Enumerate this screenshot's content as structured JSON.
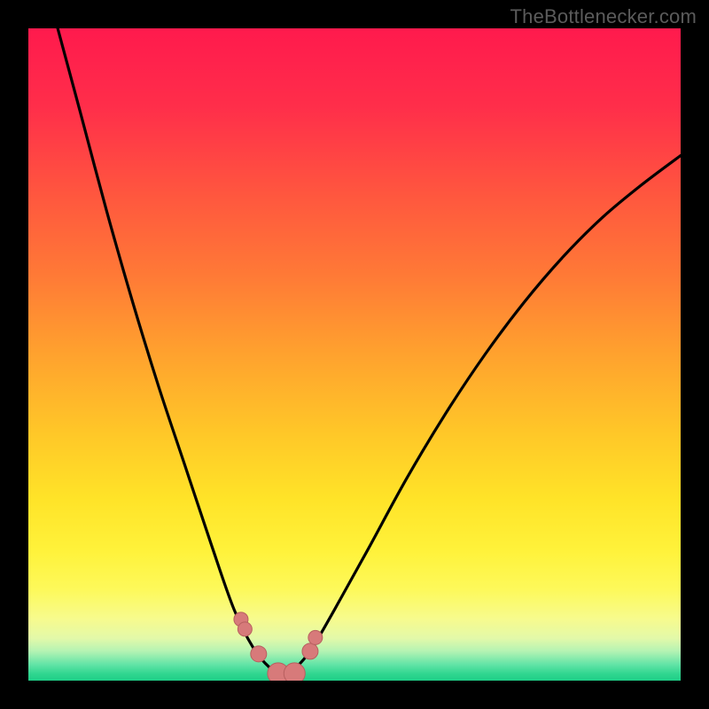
{
  "watermark": {
    "text": "TheBottlenecker.com"
  },
  "colors": {
    "background": "#000000",
    "curve": "#000000",
    "dot_fill": "#d77a7a",
    "dot_stroke": "#b75f5f",
    "gradient_stops": [
      {
        "offset": 0.0,
        "color": "#ff1a4d"
      },
      {
        "offset": 0.12,
        "color": "#ff2e4a"
      },
      {
        "offset": 0.25,
        "color": "#ff553f"
      },
      {
        "offset": 0.38,
        "color": "#ff7a36"
      },
      {
        "offset": 0.5,
        "color": "#ffa22e"
      },
      {
        "offset": 0.62,
        "color": "#ffc728"
      },
      {
        "offset": 0.72,
        "color": "#ffe328"
      },
      {
        "offset": 0.8,
        "color": "#fff23a"
      },
      {
        "offset": 0.86,
        "color": "#fdf95a"
      },
      {
        "offset": 0.905,
        "color": "#f7fb8d"
      },
      {
        "offset": 0.935,
        "color": "#e3f9a9"
      },
      {
        "offset": 0.955,
        "color": "#b4f3b3"
      },
      {
        "offset": 0.975,
        "color": "#63e4a7"
      },
      {
        "offset": 0.99,
        "color": "#2fd68f"
      },
      {
        "offset": 1.0,
        "color": "#1fcf87"
      }
    ]
  },
  "chart_data": {
    "type": "line",
    "title": "",
    "xlabel": "",
    "ylabel": "",
    "xlim": [
      0,
      1
    ],
    "ylim": [
      0,
      1
    ],
    "note": "x is normalized horizontal position (0=left,1=right); y is normalized bottleneck severity (0=green/no bottleneck at bottom, 1=red/severe at top). Curve is an asymmetric V reaching its minimum near x≈0.39.",
    "series": [
      {
        "name": "bottleneck-curve",
        "x": [
          0.045,
          0.08,
          0.12,
          0.16,
          0.2,
          0.24,
          0.28,
          0.315,
          0.345,
          0.37,
          0.39,
          0.41,
          0.435,
          0.47,
          0.52,
          0.58,
          0.64,
          0.7,
          0.76,
          0.82,
          0.88,
          0.94,
          1.0
        ],
        "y": [
          1.0,
          0.87,
          0.72,
          0.58,
          0.45,
          0.33,
          0.21,
          0.11,
          0.05,
          0.02,
          0.01,
          0.02,
          0.05,
          0.11,
          0.2,
          0.31,
          0.41,
          0.5,
          0.58,
          0.65,
          0.71,
          0.76,
          0.805
        ]
      }
    ],
    "highlight_points": {
      "name": "near-optimal-markers",
      "x": [
        0.326,
        0.332,
        0.353,
        0.383,
        0.408,
        0.432,
        0.44
      ],
      "y": [
        0.094,
        0.079,
        0.041,
        0.011,
        0.011,
        0.045,
        0.066
      ]
    }
  }
}
